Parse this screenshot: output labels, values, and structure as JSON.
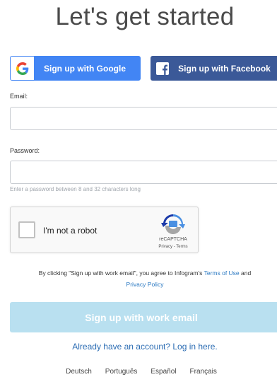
{
  "header": {
    "title": "Let's get started"
  },
  "social": {
    "google_label": "Sign up with Google",
    "facebook_label": "Sign up with Facebook"
  },
  "form": {
    "email_label": "Email:",
    "email_value": "",
    "password_label": "Password:",
    "password_value": "",
    "password_hint": "Enter a password between 8 and 32 characters long"
  },
  "captcha": {
    "label": "I'm not a robot",
    "brand": "reCAPTCHA",
    "privacy_link": "Privacy",
    "separator": " - ",
    "terms_link": "Terms"
  },
  "terms": {
    "text_before": "By clicking \"Sign up with work email\", you agree to Infogram's ",
    "terms_link": "Terms of Use",
    "text_and": " and",
    "privacy_link": "Privacy Policy"
  },
  "actions": {
    "submit_label": "Sign up with work email",
    "login_link": "Already have an account? Log in here."
  },
  "languages": [
    "Deutsch",
    "Português",
    "Español",
    "Français"
  ],
  "colors": {
    "google_blue": "#4285f4",
    "facebook_blue": "#3b5998",
    "submit_disabled": "#b9e0f0",
    "link_blue": "#2b6cb3"
  }
}
